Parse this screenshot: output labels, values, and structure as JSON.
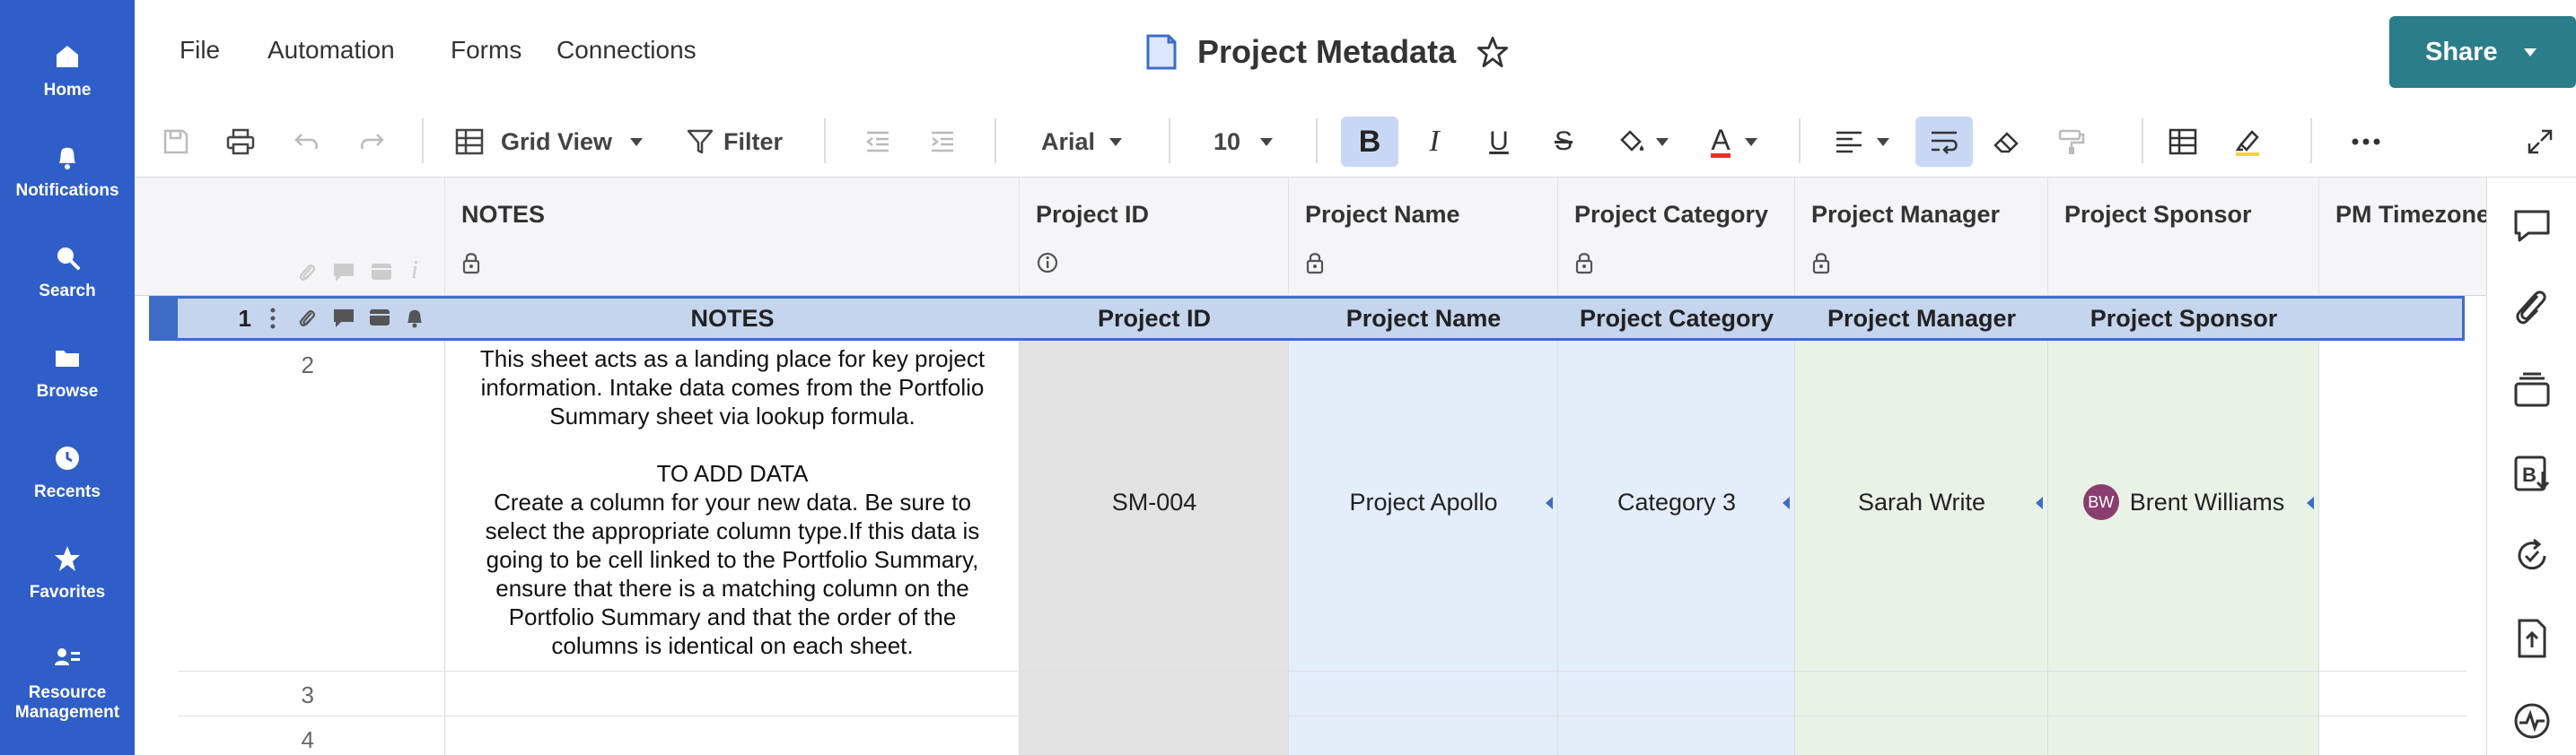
{
  "nav": {
    "items": [
      {
        "label": "Home",
        "icon": "home-icon"
      },
      {
        "label": "Notifications",
        "icon": "bell-icon"
      },
      {
        "label": "Search",
        "icon": "search-icon"
      },
      {
        "label": "Browse",
        "icon": "folder-icon"
      },
      {
        "label": "Recents",
        "icon": "clock-icon"
      },
      {
        "label": "Favorites",
        "icon": "star-icon"
      },
      {
        "label_line1": "Resource",
        "label_line2": "Management",
        "icon": "people-icon"
      }
    ]
  },
  "menu": {
    "file": "File",
    "automation": "Automation",
    "forms": "Forms",
    "connections": "Connections"
  },
  "sheet": {
    "title": "Project Metadata"
  },
  "share": {
    "label": "Share"
  },
  "toolbar": {
    "view_label": "Grid View",
    "filter_label": "Filter",
    "font_family": "Arial",
    "font_size": "10"
  },
  "columns": [
    {
      "label": "NOTES",
      "sub_icon": "lock-icon"
    },
    {
      "label": "Project ID",
      "sub_icon": "info-icon"
    },
    {
      "label": "Project Name",
      "sub_icon": "lock-icon"
    },
    {
      "label": "Project Category",
      "sub_icon": "lock-icon"
    },
    {
      "label": "Project Manager",
      "sub_icon": "lock-icon"
    },
    {
      "label": "Project Sponsor",
      "sub_icon": ""
    },
    {
      "label": "PM Timezone",
      "sub_icon": ""
    }
  ],
  "rows": {
    "r1": {
      "num": "1",
      "notes": "NOTES",
      "project_id": "Project ID",
      "project_name": "Project Name",
      "project_category": "Project Category",
      "project_manager": "Project Manager",
      "project_sponsor": "Project Sponsor"
    },
    "r2": {
      "num": "2",
      "notes": "This sheet acts as a landing place for key project\ninformation. Intake data comes from the Portfolio\nSummary sheet via lookup formula.\n\nTO ADD DATA\nCreate a column for your new data. Be sure to\nselect the appropriate column type.If this data is\ngoing to be cell linked to the Portfolio Summary,\nensure that there is a matching column on the\nPortfolio Summary and that the order of the\ncolumns is identical on each sheet.",
      "project_id": "SM-004",
      "project_name": "Project Apollo",
      "project_category": "Category 3",
      "project_manager": "Sarah Write",
      "sponsor_initials": "BW",
      "project_sponsor": "Brent Williams"
    },
    "r3": {
      "num": "3"
    },
    "r4": {
      "num": "4"
    }
  },
  "colors": {
    "nav_bg": "#2f5ec9",
    "share_bg": "#2b7d8a",
    "col_id_bg": "#e3e3e3",
    "col_blue_bg": "#e4eefb",
    "col_green_bg": "#e8f3e6",
    "header_row_bg": "#c5d5ee"
  }
}
